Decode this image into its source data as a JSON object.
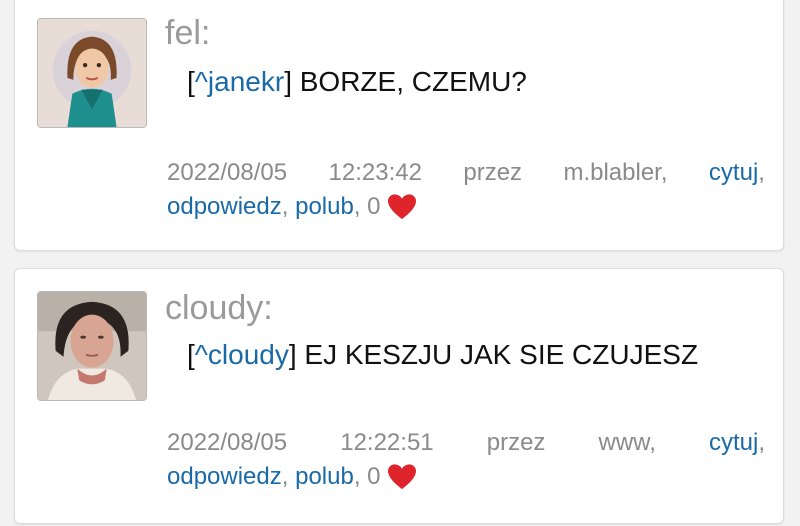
{
  "posts": [
    {
      "author": "fel:",
      "mention": "^janekr",
      "message": "BORZE, CZEMU?",
      "date": "2022/08/05",
      "time": "12:23:42",
      "by_label": "przez",
      "by_user": "m.blabler,",
      "quote_label": "cytuj",
      "reply_label": "odpowiedz",
      "like_label": "polub",
      "like_count": "0",
      "avatar_icon": "cartoon-avatar-icon"
    },
    {
      "author": "cloudy:",
      "mention": "^cloudy",
      "message": "EJ KESZJU JAK SIE CZUJESZ",
      "date": "2022/08/05",
      "time": "12:22:51",
      "by_label": "przez",
      "by_user": "www,",
      "quote_label": "cytuj",
      "reply_label": "odpowiedz",
      "like_label": "polub",
      "like_count": "0",
      "avatar_icon": "photo-avatar-icon"
    }
  ],
  "colors": {
    "link": "#1a6aa8",
    "meta": "#8a8a8a",
    "heart": "#e0242c"
  }
}
